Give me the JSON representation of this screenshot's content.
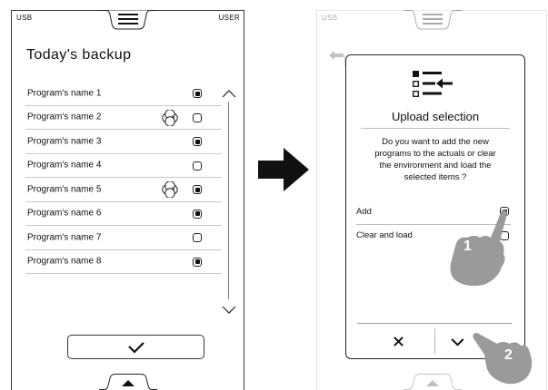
{
  "left_screen": {
    "usb_label": "USB",
    "user_label": "USER",
    "title": "Today's backup",
    "programs": [
      {
        "name": "Program's name 1",
        "checked": true,
        "icon": false
      },
      {
        "name": "Program's name 2",
        "checked": false,
        "icon": true
      },
      {
        "name": "Program's name 3",
        "checked": true,
        "icon": false
      },
      {
        "name": "Program's name 4",
        "checked": false,
        "icon": false
      },
      {
        "name": "Program's name 5",
        "checked": true,
        "icon": true
      },
      {
        "name": "Program's name 6",
        "checked": true,
        "icon": false
      },
      {
        "name": "Program's name 7",
        "checked": false,
        "icon": false
      },
      {
        "name": "Program's name 8",
        "checked": true,
        "icon": false
      }
    ],
    "icons": {
      "menu": "hamburger-menu-icon",
      "multi_phase": "multi-phase-icon",
      "scroll_up": "chevron-up-icon",
      "scroll_down": "chevron-down-icon",
      "confirm": "checkmark-icon",
      "bottom": "caret-up-icon"
    }
  },
  "right_screen": {
    "usb_label": "USB",
    "dialog": {
      "title": "Upload selection",
      "message_lines": [
        "Do you want to add the new",
        "programs to the actuals or clear",
        "the environment and load the",
        "selected items ?"
      ],
      "options": [
        {
          "label": "Add",
          "checked": true
        },
        {
          "label": "Clear and load",
          "checked": false
        }
      ],
      "icons": {
        "header": "list-import-icon",
        "cancel": "close-icon",
        "confirm": "checkmark-icon"
      }
    },
    "steps": [
      {
        "number": "1"
      },
      {
        "number": "2"
      }
    ],
    "icons": {
      "back": "back-arrow-icon",
      "pointer": "hand-pointer-icon"
    }
  },
  "between": {
    "arrow_icon": "right-arrow-icon"
  },
  "colors": {
    "outline": "#222222",
    "divider": "#c9c9c9",
    "hand": "#9a9a9a"
  }
}
